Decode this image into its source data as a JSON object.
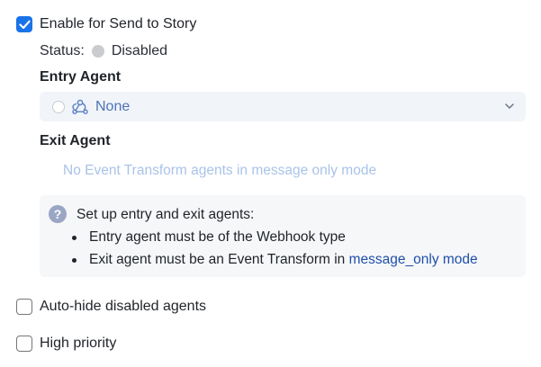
{
  "send_to_story": {
    "label": "Enable for Send to Story",
    "checked": true
  },
  "status": {
    "label": "Status:",
    "value": "Disabled"
  },
  "entry_agent": {
    "title": "Entry Agent",
    "selected": "None",
    "icon": "webhook-icon"
  },
  "exit_agent": {
    "title": "Exit Agent",
    "placeholder": "No Event Transform agents in message only mode"
  },
  "info": {
    "heading": "Set up entry and exit agents:",
    "bullet1": "Entry agent must be of the Webhook type",
    "bullet2_prefix": "Exit agent must be an Event Transform in ",
    "bullet2_link": "message_only mode"
  },
  "auto_hide": {
    "label": "Auto-hide disabled agents",
    "checked": false
  },
  "high_priority": {
    "label": "High priority",
    "checked": false
  },
  "colors": {
    "accent": "#1a73e8",
    "link": "#1f4fa8",
    "muted": "#a9c3e8"
  }
}
